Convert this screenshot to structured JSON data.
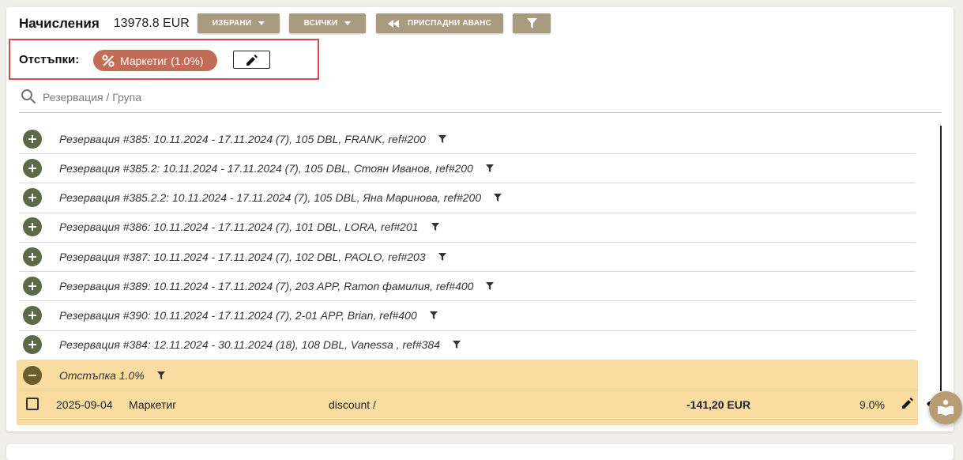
{
  "header": {
    "title": "Начисления",
    "total": "13978.8 EUR",
    "btn_selected": "ИЗБРАНИ",
    "btn_all": "ВСИЧКИ",
    "btn_advance": "ПРИСПАДНИ АВАНС"
  },
  "discounts": {
    "label": "Отстъпки:",
    "chip": "Маркетиг (1.0%)"
  },
  "search": {
    "placeholder": "Резервация / Група"
  },
  "rows": [
    "Резервация #385: 10.11.2024 - 17.11.2024 (7), 105 DBL, FRANK, ref#200",
    "Резервация #385.2: 10.11.2024 - 17.11.2024 (7), 105 DBL, Стоян Иванов, ref#200",
    "Резервация #385.2.2: 10.11.2024 - 17.11.2024 (7), 105 DBL, Яна Маринова, ref#200",
    "Резервация #386: 10.11.2024 - 17.11.2024 (7), 101 DBL, LORA, ref#201",
    "Резервация #387: 10.11.2024 - 17.11.2024 (7), 102 DBL, PAOLO, ref#203",
    "Резервация #389: 10.11.2024 - 17.11.2024 (7), 203 APP, Ramon фамилия, ref#400",
    "Резервация #390: 10.11.2024 - 17.11.2024 (7), 2-01 APP, Brian, ref#400",
    "Резервация #384: 12.11.2024 - 30.11.2024 (18), 108 DBL, Vanessa , ref#384"
  ],
  "expanded": {
    "title": "Отстъпка 1.0%",
    "item": {
      "date": "2025-09-04",
      "name": "Маркетиг",
      "type": "discount /",
      "amount": "-141,20 EUR",
      "percent": "9.0%"
    }
  },
  "colors": {
    "accent": "#a89b80",
    "chip": "#c26b57",
    "highlight_row": "#f8dca0",
    "plus": "#5c6a48"
  }
}
